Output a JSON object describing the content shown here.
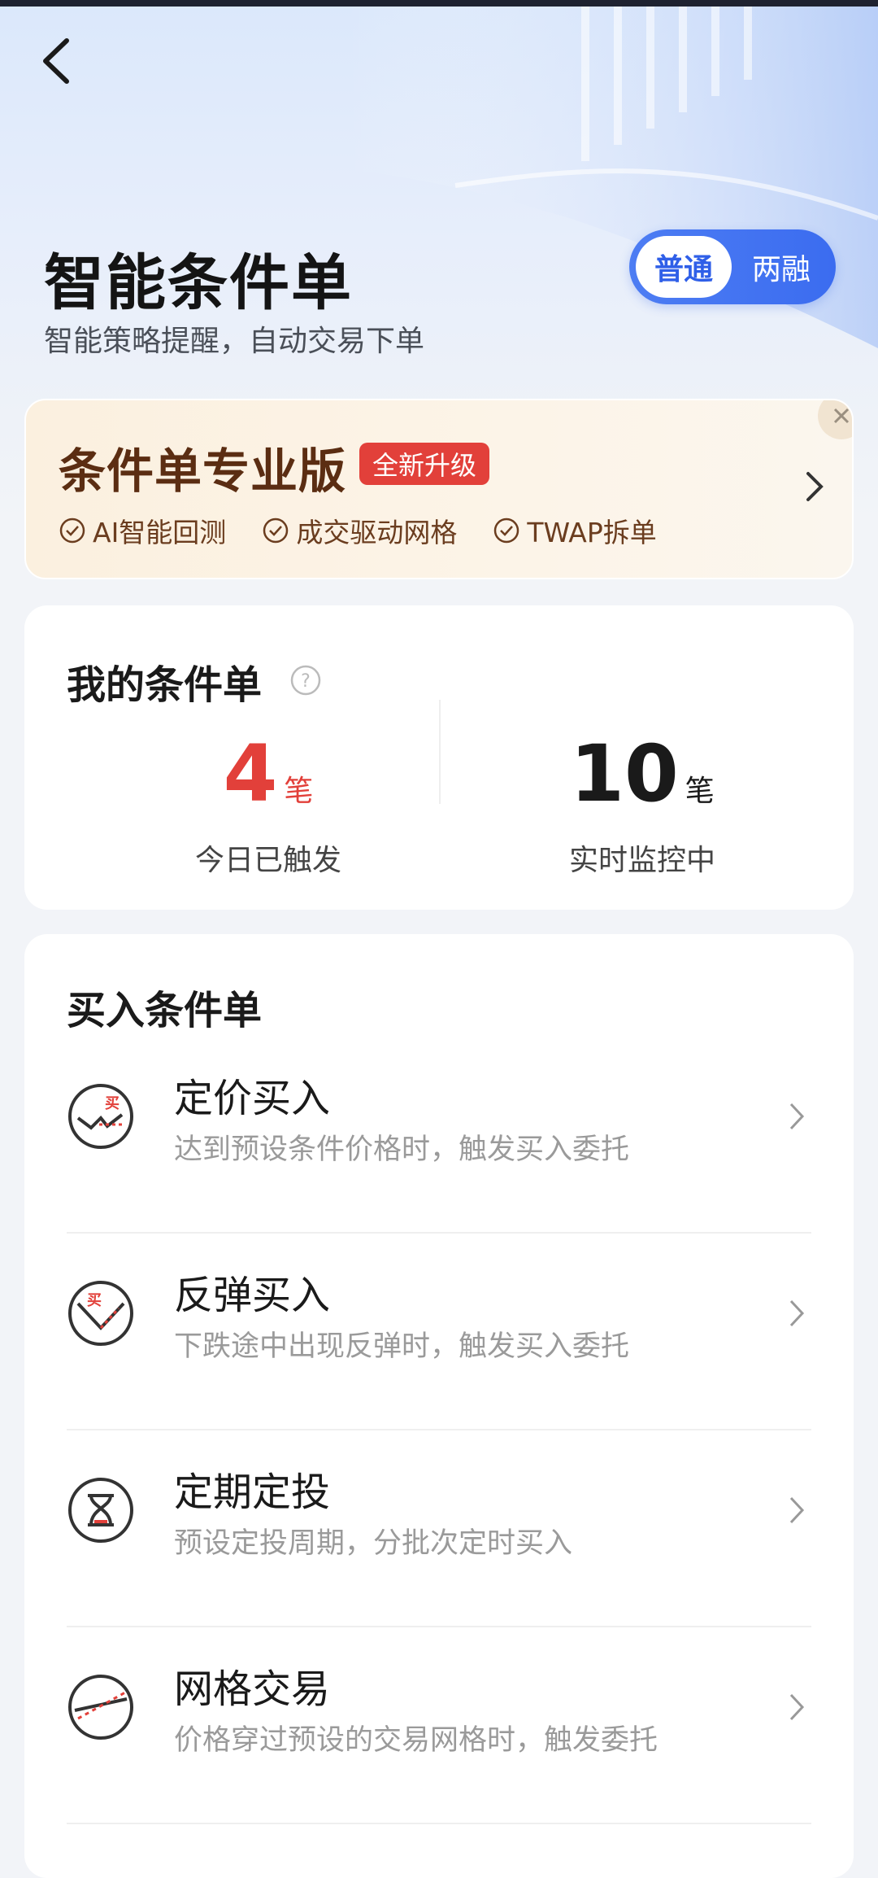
{
  "header": {
    "title": "智能条件单",
    "subtitle": "智能策略提醒，自动交易下单",
    "segment": {
      "active": "普通",
      "inactive": "两融"
    }
  },
  "promo": {
    "title": "条件单专业版",
    "badge": "全新升级",
    "features": [
      "AI智能回测",
      "成交驱动网格",
      "TWAP拆单"
    ]
  },
  "my_orders": {
    "title": "我的条件单",
    "stats": [
      {
        "value": "4",
        "unit": "笔",
        "label": "今日已触发"
      },
      {
        "value": "10",
        "unit": "笔",
        "label": "实时监控中"
      }
    ]
  },
  "buy_section": {
    "title": "买入条件单",
    "items": [
      {
        "title": "定价买入",
        "desc": "达到预设条件价格时，触发买入委托",
        "icon": "price-buy-icon",
        "badge": "买"
      },
      {
        "title": "反弹买入",
        "desc": "下跌途中出现反弹时，触发买入委托",
        "icon": "rebound-buy-icon",
        "badge": "买"
      },
      {
        "title": "定期定投",
        "desc": "预设定投周期，分批次定时买入",
        "icon": "hourglass-icon"
      },
      {
        "title": "网格交易",
        "desc": "价格穿过预设的交易网格时，触发委托",
        "icon": "grid-trade-icon"
      }
    ]
  },
  "colors": {
    "accent_blue": "#3b6cf0",
    "stat_red": "#e2403a",
    "promo_brown": "#5b2d12"
  }
}
